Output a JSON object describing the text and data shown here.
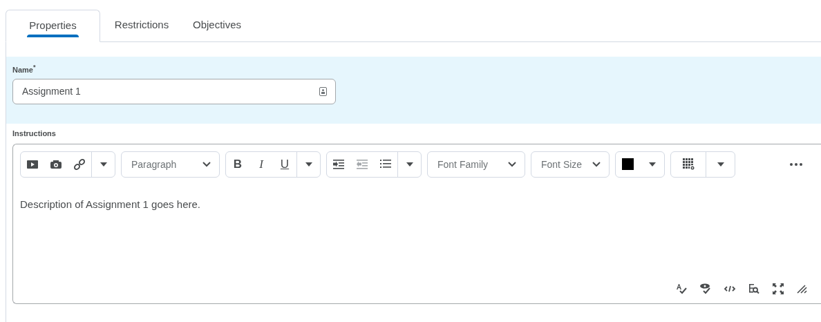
{
  "tabs": [
    {
      "label": "Properties",
      "selected": true
    },
    {
      "label": "Restrictions",
      "selected": false
    },
    {
      "label": "Objectives",
      "selected": false
    }
  ],
  "name_field": {
    "label": "Name$^{*}$",
    "value": "Assignment 1"
  },
  "instructions": {
    "label": "Instructions",
    "toolbar": {
      "block_select": "Paragraph",
      "font_family": "Font Family",
      "font_size": "Font Size",
      "format_buttons": [
        {
          "label": "B",
          "kind": "bold"
        },
        {
          "label": "I",
          "kind": "italic"
        },
        {
          "label": "U",
          "kind": "underline"
        }
      ]
    },
    "content": "Description of Assignment 1 goes here."
  }
}
